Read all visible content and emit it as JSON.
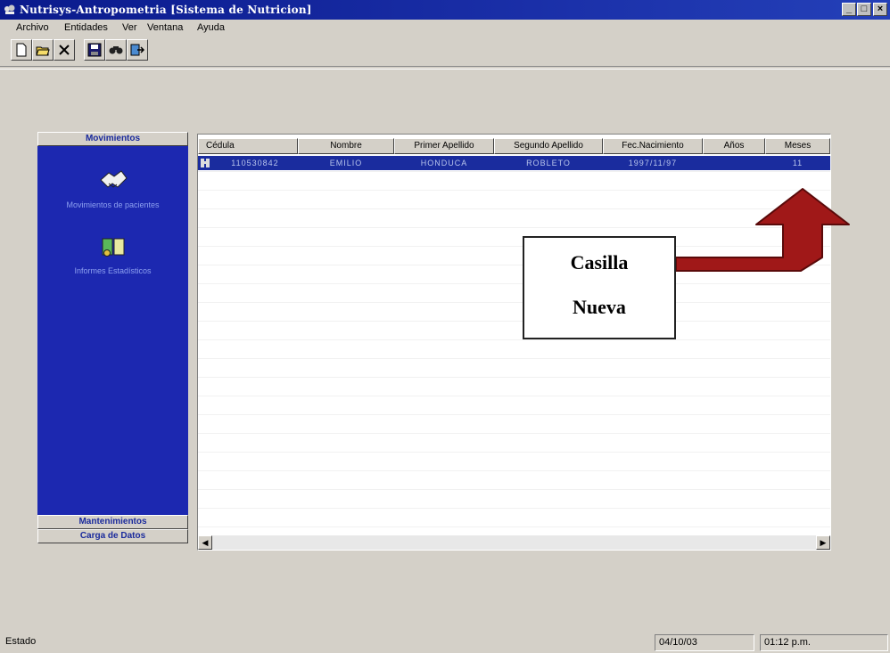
{
  "window": {
    "title": "Nutrisys-Antropometria [Sistema de Nutricion]",
    "controls": {
      "minimize": "_",
      "maximize": "□",
      "close": "×"
    }
  },
  "menu": [
    {
      "label": "Archivo"
    },
    {
      "label": "Entidades"
    },
    {
      "label": "Ver"
    },
    {
      "label": "Ventana"
    },
    {
      "label": "Ayuda"
    }
  ],
  "toolbar": {
    "buttons": [
      "new-icon",
      "open-icon",
      "delete-icon",
      "save-icon",
      "find-icon",
      "exit-icon"
    ]
  },
  "sidebar": {
    "header_top": "Movimientos",
    "items": [
      {
        "label": "Movimientos de pacientes",
        "icon": "handshake-icon"
      },
      {
        "label": "Informes Estadísticos",
        "icon": "book-icon"
      }
    ],
    "header_mid": "Mantenimientos",
    "header_bottom": "Carga de Datos"
  },
  "grid": {
    "columns": [
      "Cédula",
      "Nombre",
      "Primer Apellido",
      "Segundo Apellido",
      "Fec.Nacimiento",
      "Años",
      "Meses"
    ],
    "selected_row": [
      "110530842",
      "EMILIO",
      "HONDUCA",
      "ROBLETO",
      "1997/11/97",
      "",
      "11"
    ]
  },
  "annotation": {
    "line1": "Casilla",
    "line2": "Nueva",
    "arrow_color": "#a01818"
  },
  "status": {
    "label": "Estado",
    "date": "04/10/03",
    "time": "01:12 p.m."
  },
  "colors": {
    "title_bar": "#0a1a8c",
    "sidebar": "#1c28b0",
    "selection": "#1a2c9e"
  }
}
